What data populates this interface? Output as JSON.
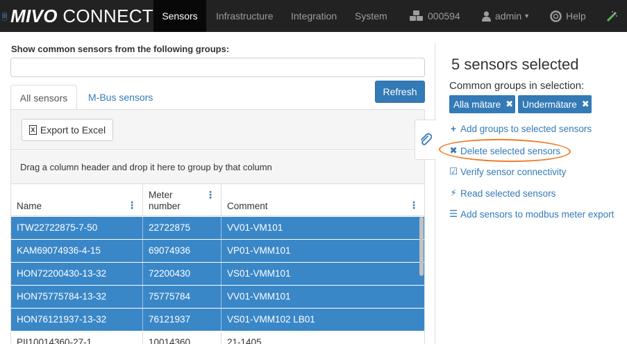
{
  "app": {
    "brand_bold": "MIVO",
    "brand_rest": " CONNECT"
  },
  "nav": {
    "items": [
      {
        "label": "Sensors",
        "active": true
      },
      {
        "label": "Infrastructure",
        "active": false
      },
      {
        "label": "Integration",
        "active": false
      },
      {
        "label": "System",
        "active": false
      }
    ],
    "org_id": "000594",
    "user": "admin",
    "help": "Help"
  },
  "filter": {
    "label": "Show common sensors from the following groups:",
    "value": ""
  },
  "tabs": [
    {
      "label": "All sensors",
      "active": true
    },
    {
      "label": "M-Bus sensors",
      "active": false
    }
  ],
  "refresh_label": "Refresh",
  "grid": {
    "export_label": "Export to Excel",
    "group_hint": "Drag a column header and drop it here to group by that column",
    "columns": [
      "Name",
      "Meter number",
      "Comment"
    ],
    "rows": [
      {
        "name": "ITW22722875-7-50",
        "meter": "22722875",
        "comment": "VV01-VM101",
        "selected": true
      },
      {
        "name": "KAM69074936-4-15",
        "meter": "69074936",
        "comment": "VP01-VMM101",
        "selected": true
      },
      {
        "name": "HON72200430-13-32",
        "meter": "72200430",
        "comment": "VS01-VMM101",
        "selected": true
      },
      {
        "name": "HON75775784-13-32",
        "meter": "75775784",
        "comment": "VV01-VMM101",
        "selected": true
      },
      {
        "name": "HON76121937-13-32",
        "meter": "76121937",
        "comment": "VS01-VMM102 LB01",
        "selected": true
      },
      {
        "name": "PII10014360-27-1",
        "meter": "10014360",
        "comment": "21-1405",
        "selected": false
      }
    ]
  },
  "selection": {
    "title": "5 sensors selected",
    "groups_label": "Common groups in selection:",
    "groups": [
      "Alla mätare",
      "Undermätare"
    ],
    "actions": [
      {
        "icon": "plus-icon",
        "label": "Add groups to selected sensors"
      },
      {
        "icon": "times-icon",
        "label": "Delete selected sensors"
      },
      {
        "icon": "check-square-icon",
        "label": "Verify sensor connectivity"
      },
      {
        "icon": "bolt-icon",
        "label": "Read selected sensors"
      },
      {
        "icon": "list-icon",
        "label": "Add sensors to modbus meter export"
      }
    ]
  },
  "colors": {
    "navbar": "#222222",
    "accent": "#337ab7",
    "selected_row": "#3a87c8",
    "highlight_circle": "#f07c2a"
  }
}
